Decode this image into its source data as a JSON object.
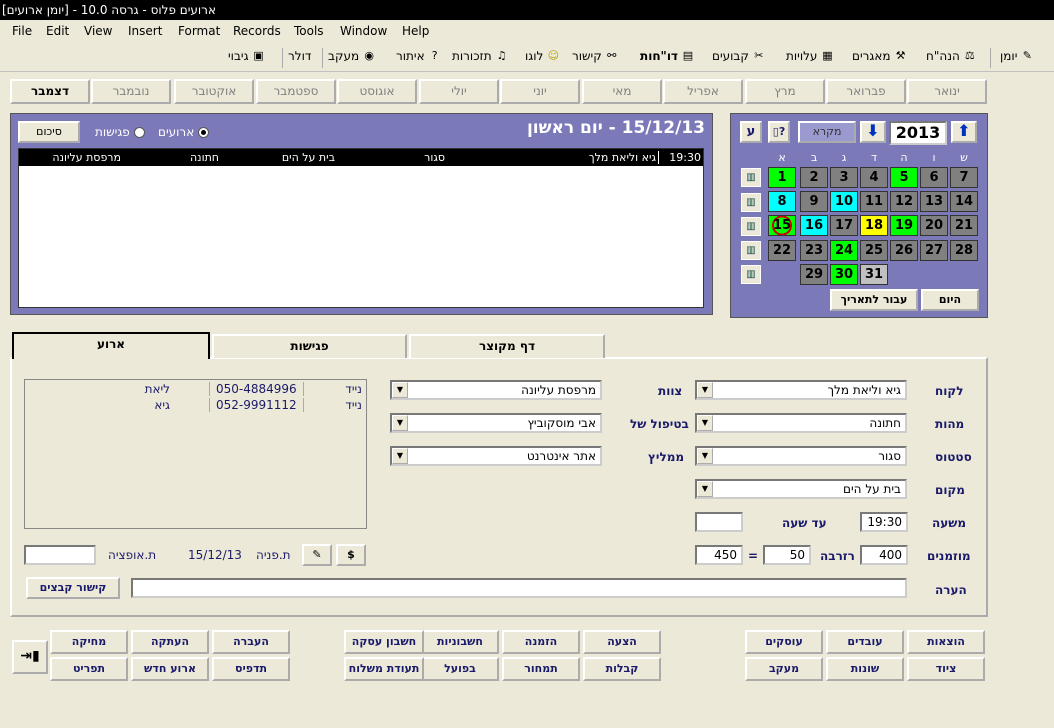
{
  "window": {
    "title": "ארועים פלוס - גרסה 10.0 - [יומן ארועים]"
  },
  "menu": [
    "File",
    "Edit",
    "View",
    "Insert",
    "Format",
    "Records",
    "Tools",
    "Window",
    "Help"
  ],
  "toolbar": {
    "items": [
      "יומן",
      "הנה\"ח",
      "מאגרים",
      "עלויות",
      "קבועים",
      "דו\"חות",
      "קישור",
      "לוגו",
      "תזכורות",
      "איתור",
      "מעקב",
      "דולר",
      "גיבוי"
    ],
    "icons": [
      "pencil-icon",
      "scales-icon",
      "tools-icon",
      "calculator-icon",
      "calculator-icon",
      "report-icon",
      "link-icon",
      "smiley-icon",
      "bell-icon",
      "question-icon",
      "eye-icon",
      "",
      "save-icon"
    ]
  },
  "months": [
    "ינואר",
    "פברואר",
    "מרץ",
    "אפריל",
    "מאי",
    "יוני",
    "יולי",
    "אוגוסט",
    "ספטמבר",
    "אוקטובר",
    "נובמבר",
    "דצמבר"
  ],
  "calendar": {
    "year": "2013",
    "legend_btn": "מקרא",
    "exit_btn": "ע",
    "today_btn": "היום",
    "goto_btn": "עבור לתאריך",
    "weekdays": [
      "ש",
      "ו",
      "ה",
      "ד",
      "ג",
      "ב",
      "א"
    ],
    "rows": [
      [
        [
          "7",
          "g"
        ],
        [
          "6",
          "g"
        ],
        [
          "5",
          "G"
        ],
        [
          "4",
          "g"
        ],
        [
          "3",
          "g"
        ],
        [
          "2",
          "g"
        ],
        [
          "1",
          "G"
        ]
      ],
      [
        [
          "14",
          "g"
        ],
        [
          "13",
          "g"
        ],
        [
          "12",
          "g"
        ],
        [
          "11",
          "g"
        ],
        [
          "10",
          "C"
        ],
        [
          "9",
          "g"
        ],
        [
          "8",
          "C"
        ]
      ],
      [
        [
          "21",
          "g"
        ],
        [
          "20",
          "g"
        ],
        [
          "19",
          "G"
        ],
        [
          "18",
          "Y"
        ],
        [
          "17",
          "g"
        ],
        [
          "16",
          "C"
        ],
        [
          "15",
          "G"
        ]
      ],
      [
        [
          "28",
          "g"
        ],
        [
          "27",
          "g"
        ],
        [
          "26",
          "g"
        ],
        [
          "25",
          "g"
        ],
        [
          "24",
          "G"
        ],
        [
          "23",
          "g"
        ],
        [
          "22",
          "g"
        ]
      ],
      [
        [
          "",
          "x"
        ],
        [
          "",
          "x"
        ],
        [
          "",
          "x"
        ],
        [
          "31",
          "L"
        ],
        [
          "30",
          "G"
        ],
        [
          "29",
          "g"
        ],
        [
          "",
          "x"
        ]
      ]
    ]
  },
  "day_panel": {
    "title": "15/12/13 - יום ראשון",
    "radio_events": "ארועים",
    "radio_meetings": "פגישות",
    "summary_btn": "סיכום",
    "rows": [
      [
        "19:30",
        "גיא וליאת מלך",
        "סגור",
        "בית על הים",
        "חתונה",
        "מרפסת עליונה"
      ]
    ]
  },
  "tabs": [
    "ארוע",
    "פגישות",
    "דף מקוצר"
  ],
  "form": {
    "customer_label": "לקוח",
    "customer": "גיא וליאת מלך",
    "type_label": "מהות",
    "type": "חתונה",
    "status_label": "סטטוס",
    "status": "סגור",
    "place_label": "מקום",
    "place": "בית על הים",
    "time_label": "משעה",
    "time": "19:30",
    "until_label": "עד שעה",
    "until": "",
    "guests_label": "מוזמנים",
    "guests": "400",
    "reserve_label": "רזרבה",
    "reserve": "50",
    "eq": "=",
    "total": "450",
    "note_label": "הערה",
    "note": "",
    "team_label": "צוות",
    "team": "מרפסת עליונה",
    "handler_label": "בטיפול של",
    "handler": "אבי מוסקוביץ",
    "recommender_label": "ממליץ",
    "recommender": "אתר אינטרנט",
    "contacts": [
      [
        "נייד",
        "050-4884996",
        "ליאת"
      ],
      [
        "נייד",
        "052-9991112",
        "גיא"
      ]
    ],
    "inquiry_label": "ת.פניה",
    "inquiry_date": "15/12/13",
    "option_label": "ת.אופציה",
    "option": "",
    "dollar": "$",
    "files_btn": "קישור קבצים"
  },
  "bottom": [
    [
      "הוצאות",
      "עובדים",
      "עוסקים",
      "הצעה",
      "הזמנה",
      "חשבוניות",
      "חשבון עסקה",
      "העברה",
      "העתקה",
      "מחיקה"
    ],
    [
      "ציוד",
      "שונות",
      "מעקב",
      "קבלות",
      "תמחור",
      "בפועל",
      "תעודת משלוח",
      "תדפיס",
      "ארוע חדש",
      "תפריט"
    ]
  ],
  "colors": {
    "g": "#808080",
    "G": "#00ff00",
    "C": "#00ffff",
    "Y": "#ffff00",
    "L": "#c0c0c0",
    "panel": "#7b79b8"
  }
}
